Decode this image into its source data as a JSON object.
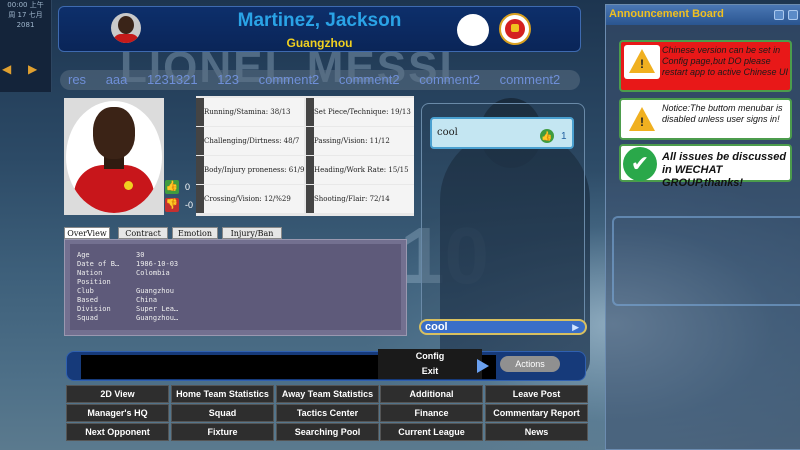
{
  "clock": {
    "line1": "00:00 上午",
    "line2": "周 17 七月",
    "line3": "2081"
  },
  "header": {
    "player_name": "Martinez, Jackson",
    "club": "Guangzhou"
  },
  "background": {
    "watermark": "LIONEL MESSI",
    "number": "10"
  },
  "ticker": [
    "res",
    "aaa",
    "1231321",
    "123",
    "comment2",
    "comment2",
    "comment2",
    "comment2"
  ],
  "player": {
    "likes": "0",
    "dislikes": "-0"
  },
  "attributes": [
    "Running/Stamina: 38/13",
    "Set Piece/Technique: 19/13",
    "Challenging/Dirtness: 48/7",
    "Passing/Vision: 11/12",
    "Body/Injury proneness: 61/9",
    "Heading/Work Rate: 15/15",
    "Crossing/Vision: 12/%29",
    "Shooting/Flair: 72/14"
  ],
  "tabs": [
    "OverView",
    "Contract",
    "Emotion",
    "Injury/Ban"
  ],
  "overview": [
    {
      "label": "Age",
      "value": "30"
    },
    {
      "label": "Date of B…",
      "value": "1986-10-03"
    },
    {
      "label": "Nation",
      "value": "Colombia"
    },
    {
      "label": "Position",
      "value": ""
    },
    {
      "label": "Club",
      "value": "Guangzhou"
    },
    {
      "label": "Based",
      "value": "China"
    },
    {
      "label": "Division",
      "value": "Super Lea…"
    },
    {
      "label": "Squad",
      "value": "Guangzhou…"
    }
  ],
  "comment": {
    "text": "cool",
    "likes": "1",
    "input_value": "cool"
  },
  "menu": {
    "config": "Config",
    "exit": "Exit",
    "actions": "Actions"
  },
  "buttons": [
    [
      "2D View",
      "Home Team Statistics",
      "Away Team Statistics",
      "Additional",
      "Leave Post"
    ],
    [
      "Manager's HQ",
      "Squad",
      "Tactics Center",
      "Finance",
      "Commentary Report"
    ],
    [
      "Next Opponent",
      "Fixture",
      "Searching Pool",
      "Current League",
      "News"
    ]
  ],
  "announcement": {
    "title": "Announcement Board",
    "messages": [
      "Chinese version can be set in Config page,but DO please restart app to active Chinese UI",
      "Notice:The buttom menubar is disabled unless user signs in!",
      "All issues be discussed in WECHAT GROUP,thanks!"
    ]
  },
  "colors": {
    "name": "#2aa3e6",
    "club": "#f0d020",
    "ticker": "#6f8fd8",
    "announce_title": "#f0c020"
  }
}
